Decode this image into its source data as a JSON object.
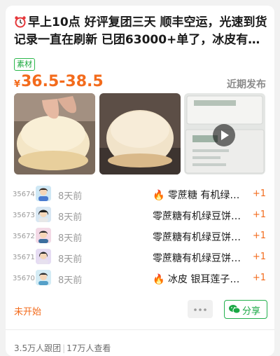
{
  "post": {
    "title": "早上10点 好评复团三天 顺丰空运，光速到货 记录一直在刷新 已团63000+单了，冰皮有…",
    "title_icons": [
      "alarm-clock-icon",
      "refresh-icon"
    ],
    "tag": "素材",
    "currency": "¥",
    "price_range": "36.5-38.5",
    "recent_label": "近期发布",
    "media": [
      {
        "type": "image",
        "name": "bun-in-hand-photo"
      },
      {
        "type": "image",
        "name": "bun-on-plate-photo"
      },
      {
        "type": "video",
        "name": "mung-bean-cake-box-video",
        "icon": "play-icon"
      }
    ]
  },
  "orders": [
    {
      "num": "35674",
      "time": "8天前",
      "fire": true,
      "product": "零蔗糖 有机绿…",
      "count": "+1"
    },
    {
      "num": "35673",
      "time": "8天前",
      "fire": false,
      "product": "零蔗糖有机绿豆饼…",
      "count": "+1"
    },
    {
      "num": "35672",
      "time": "8天前",
      "fire": false,
      "product": "零蔗糖有机绿豆饼…",
      "count": "+1"
    },
    {
      "num": "35671",
      "time": "8天前",
      "fire": false,
      "product": "零蔗糖有机绿豆饼…",
      "count": "+1"
    },
    {
      "num": "35670",
      "time": "8天前",
      "fire": true,
      "product": "冰皮 银耳莲子…",
      "count": "+1"
    }
  ],
  "footer": {
    "status": "未开始",
    "more_icon": "more-dots-icon",
    "share_label": "分享",
    "share_icon": "wechat-icon",
    "followers": "3.5万人跟团",
    "separator": "|",
    "views": "17万人查看"
  },
  "colors": {
    "accent": "#f36b1c",
    "green": "#23b04d",
    "muted": "#9a9a9a"
  }
}
